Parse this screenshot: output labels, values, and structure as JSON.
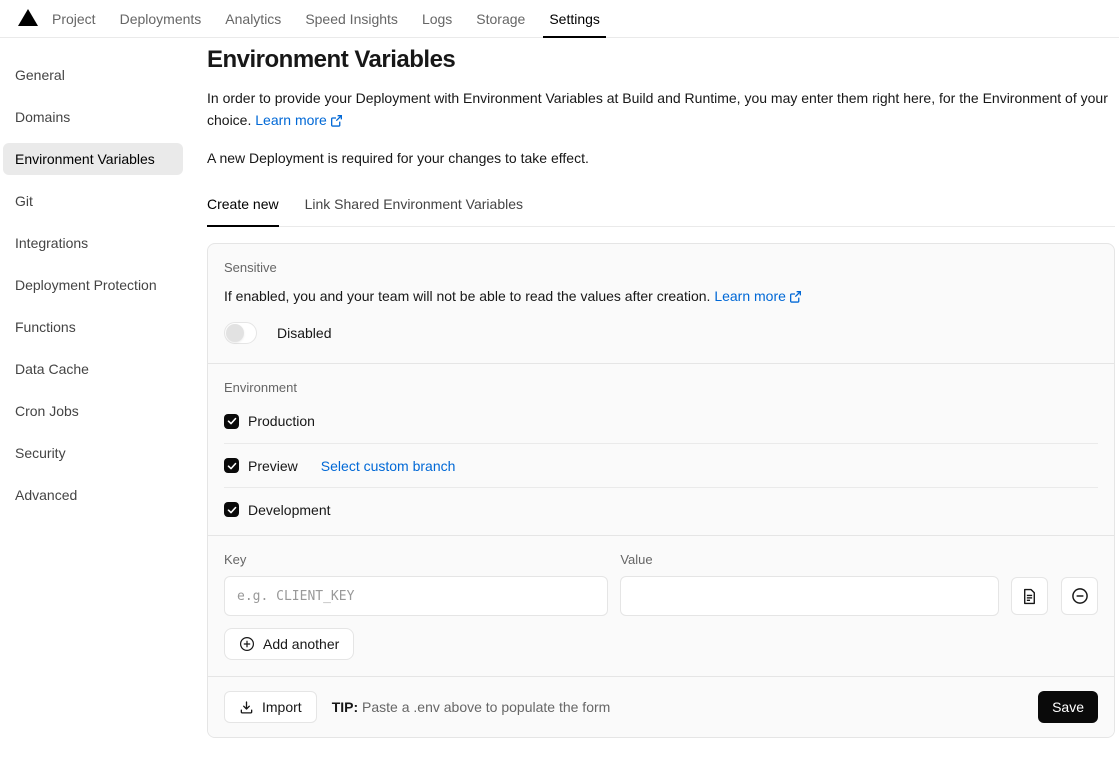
{
  "nav": {
    "items": [
      {
        "label": "Project"
      },
      {
        "label": "Deployments"
      },
      {
        "label": "Analytics"
      },
      {
        "label": "Speed Insights"
      },
      {
        "label": "Logs"
      },
      {
        "label": "Storage"
      },
      {
        "label": "Settings",
        "active": true
      }
    ]
  },
  "sidebar": {
    "items": [
      {
        "label": "General"
      },
      {
        "label": "Domains"
      },
      {
        "label": "Environment Variables",
        "active": true
      },
      {
        "label": "Git"
      },
      {
        "label": "Integrations"
      },
      {
        "label": "Deployment Protection"
      },
      {
        "label": "Functions"
      },
      {
        "label": "Data Cache"
      },
      {
        "label": "Cron Jobs"
      },
      {
        "label": "Security"
      },
      {
        "label": "Advanced"
      }
    ]
  },
  "page": {
    "title": "Environment Variables",
    "description": "In order to provide your Deployment with Environment Variables at Build and Runtime, you may enter them right here, for the Environment of your choice.",
    "learn_more": "Learn more",
    "deployment_note": "A new Deployment is required for your changes to take effect."
  },
  "tabs": [
    {
      "label": "Create new",
      "active": true
    },
    {
      "label": "Link Shared Environment Variables"
    }
  ],
  "form": {
    "sensitive": {
      "label": "Sensitive",
      "description": "If enabled, you and your team will not be able to read the values after creation.",
      "learn_more": "Learn more",
      "toggle_state": "Disabled"
    },
    "environment": {
      "label": "Environment",
      "options": [
        {
          "label": "Production",
          "checked": true
        },
        {
          "label": "Preview",
          "checked": true,
          "link": "Select custom branch"
        },
        {
          "label": "Development",
          "checked": true
        }
      ]
    },
    "key": {
      "label": "Key",
      "placeholder": "e.g. CLIENT_KEY",
      "value": ""
    },
    "value": {
      "label": "Value",
      "placeholder": "",
      "value": ""
    },
    "add_another": "Add another",
    "footer": {
      "import": "Import",
      "tip_label": "TIP:",
      "tip_text": "Paste a .env above to populate the form",
      "save": "Save"
    }
  },
  "colors": {
    "accent_blue": "#0068d6",
    "sidebar_active_bg": "#eaeaea",
    "card_bg": "#fafafa",
    "save_button_bg": "#0a0a0a",
    "border": "#e5e5e5"
  }
}
